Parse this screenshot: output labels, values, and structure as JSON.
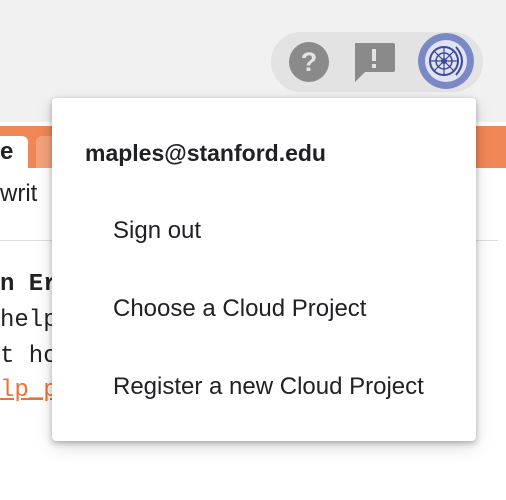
{
  "toolbar": {
    "help_icon": "help-circle-icon",
    "feedback_icon": "feedback-icon",
    "avatar_icon": "account-avatar",
    "pill_color": "#e3e3e3",
    "icon_color": "#8a8a8a"
  },
  "tabs": {
    "active_label": "e",
    "strip_color": "#f08757"
  },
  "background_text": {
    "write_fragment": "writ",
    "code_lines": [
      "n Er",
      "help",
      "t ho",
      "lp_p"
    ]
  },
  "account_menu": {
    "email": "maples@stanford.edu",
    "items": [
      {
        "label": "Sign out"
      },
      {
        "label": "Choose a Cloud Project"
      },
      {
        "label": "Register a new Cloud Project"
      }
    ]
  }
}
